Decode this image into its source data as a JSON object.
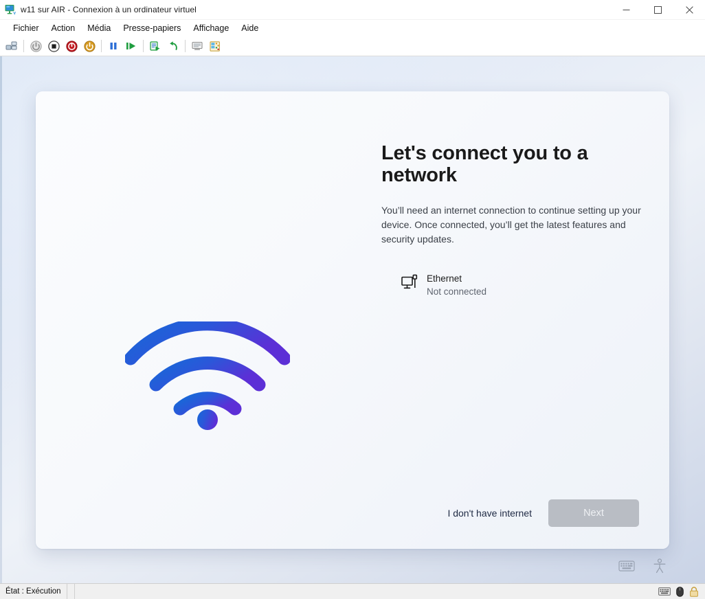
{
  "window": {
    "title": "w11 sur AIR - Connexion à un ordinateur virtuel",
    "icon": "virtual-machine-monitor-icon",
    "controls": {
      "minimize": "Réduire",
      "maximize": "Agrandir",
      "close": "Fermer"
    }
  },
  "menubar": {
    "items": [
      {
        "label": "Fichier",
        "name": "menu-fichier"
      },
      {
        "label": "Action",
        "name": "menu-action"
      },
      {
        "label": "Média",
        "name": "menu-media"
      },
      {
        "label": "Presse-papiers",
        "name": "menu-presse-papiers"
      },
      {
        "label": "Affichage",
        "name": "menu-affichage"
      },
      {
        "label": "Aide",
        "name": "menu-aide"
      }
    ]
  },
  "toolbar": {
    "buttons": [
      {
        "name": "ctrl-alt-suppr-icon",
        "tooltip": "Ctrl+Alt+Suppr",
        "color": "#6d7e8f"
      },
      {
        "name": "power-off-icon",
        "tooltip": "Arrêter",
        "color": "#9b9b9b"
      },
      {
        "name": "stop-icon",
        "tooltip": "Désactiver",
        "color": "#2b2b2b"
      },
      {
        "name": "shutdown-icon",
        "tooltip": "Arrêter le système",
        "color": "#c21b22"
      },
      {
        "name": "start-power-icon",
        "tooltip": "Démarrer",
        "color": "#d79b22"
      },
      {
        "name": "pause-icon",
        "tooltip": "Suspendre",
        "color": "#2e6fd6"
      },
      {
        "name": "resume-icon",
        "tooltip": "Reprendre",
        "color": "#1f9d3f"
      },
      {
        "name": "checkpoint-icon",
        "tooltip": "Point de contrôle",
        "color": "#1f9d3f"
      },
      {
        "name": "revert-icon",
        "tooltip": "Rétablir",
        "color": "#1f9d3f"
      },
      {
        "name": "enhanced-session-icon",
        "tooltip": "Session étendue",
        "color": "#8d8d8d"
      },
      {
        "name": "settings-icon",
        "tooltip": "Paramètres",
        "color": "#d79b22"
      }
    ],
    "separators_after": [
      0,
      4,
      6,
      8
    ]
  },
  "oobe": {
    "title": "Let's connect you to a network",
    "body": "You’ll need an internet connection to continue setting up your device. Once connected, you’ll get the latest features and security updates.",
    "wifi_art": {
      "name": "wifi-illustration",
      "gradient_from": "#1669d8",
      "gradient_to": "#5c2fd6"
    },
    "networks": [
      {
        "icon": "ethernet-icon",
        "name": "Ethernet",
        "status": "Not connected"
      }
    ],
    "actions": {
      "no_internet_label": "I don't have internet",
      "next_label": "Next",
      "next_disabled": true
    }
  },
  "vm_corner_icons": [
    {
      "name": "on-screen-keyboard-icon"
    },
    {
      "name": "accessibility-icon"
    }
  ],
  "statusbar": {
    "state_label": "État : Exécution",
    "icons": [
      {
        "name": "keyboard-capture-icon"
      },
      {
        "name": "mouse-capture-icon"
      },
      {
        "name": "lock-icon",
        "color": "#e0b64a"
      }
    ]
  }
}
